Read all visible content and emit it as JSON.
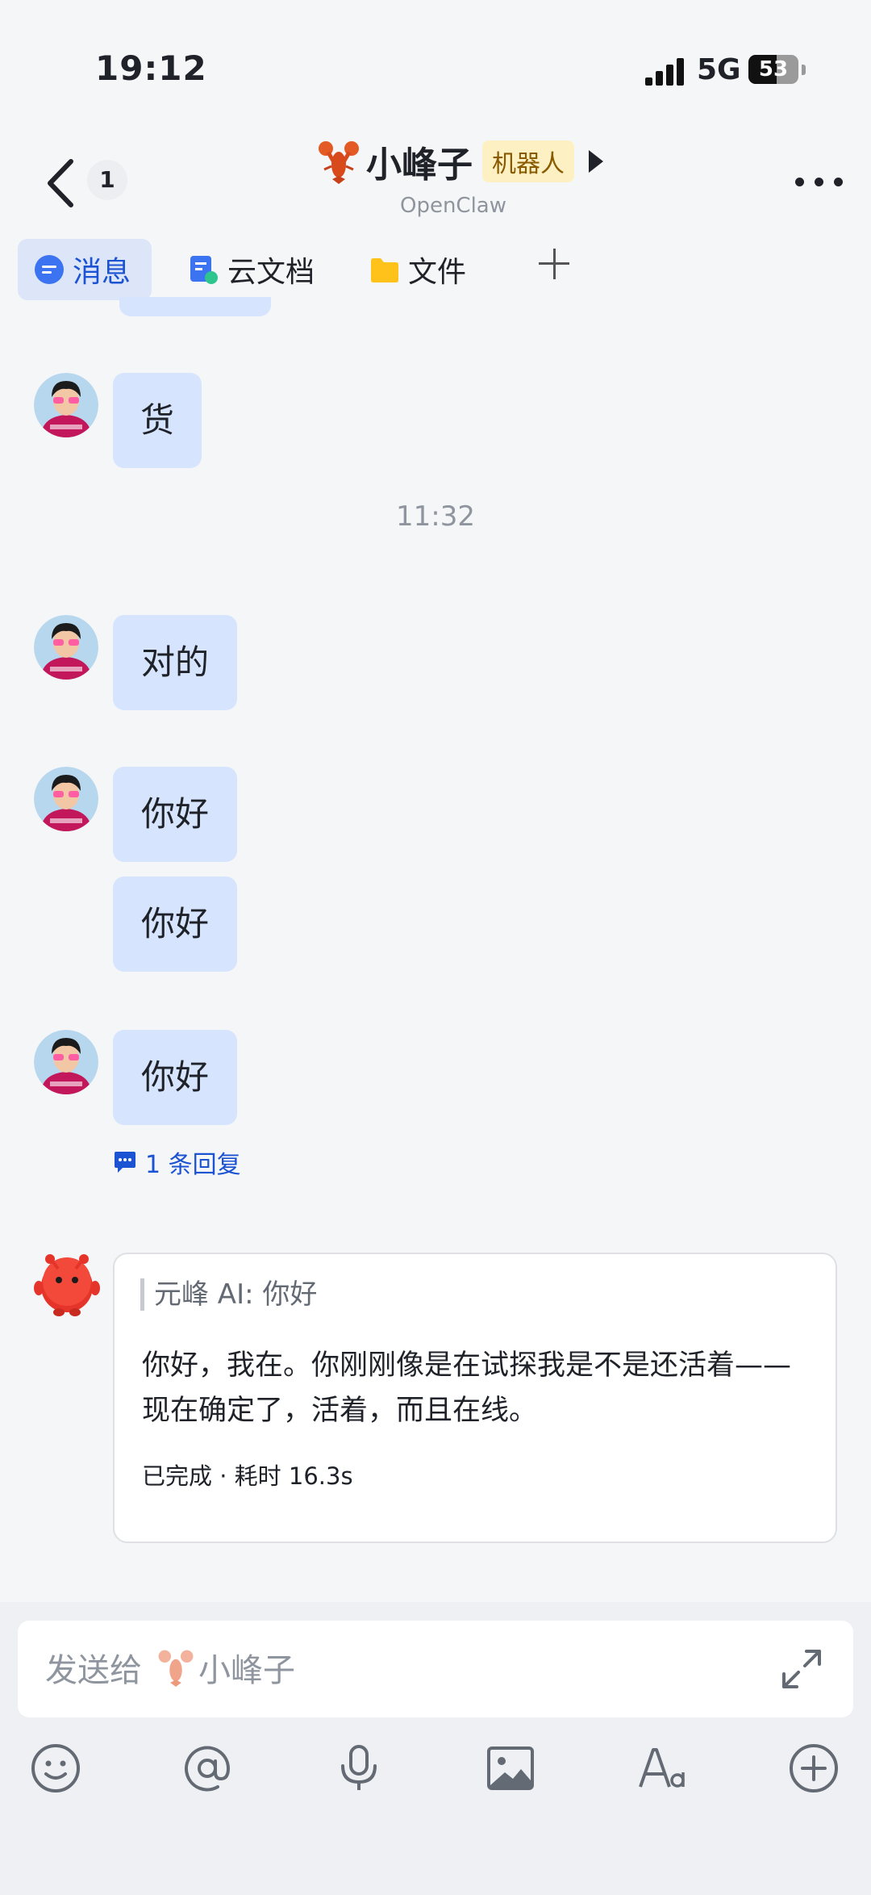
{
  "status_bar": {
    "time": "19:12",
    "network": "5G",
    "battery": "53"
  },
  "header": {
    "back_count": "1",
    "title": "小峰子",
    "badge": "机器人",
    "subtitle": "OpenClaw"
  },
  "tabs": [
    {
      "label": "消息",
      "active": true
    },
    {
      "label": "云文档"
    },
    {
      "label": "文件"
    }
  ],
  "messages": [
    {
      "text": "货"
    },
    {
      "text": "对的"
    },
    {
      "text": "你好"
    },
    {
      "text": "你好"
    },
    {
      "text": "你好"
    }
  ],
  "time_separator": "11:32",
  "thread_reply": "1 条回复",
  "bot_reply": {
    "quote": "元峰 AI: 你好",
    "text": "你好，我在。你刚刚像是在试探我是不是还活着——现在确定了，活着，而且在线。",
    "status": "已完成 · 耗时 16.3s"
  },
  "input": {
    "placeholder_prefix": "发送给",
    "recipient": "小峰子"
  },
  "colors": {
    "accent": "#1b53d3",
    "bubble": "#d6e5fd",
    "badge_bg": "#fdf1c4"
  },
  "icons": [
    "back-icon",
    "more-icon",
    "message-icon",
    "doc-icon",
    "folder-icon",
    "plus-icon",
    "reply-icon",
    "expand-icon",
    "emoji-icon",
    "at-icon",
    "mic-icon",
    "image-icon",
    "font-icon",
    "add-circle-icon"
  ]
}
